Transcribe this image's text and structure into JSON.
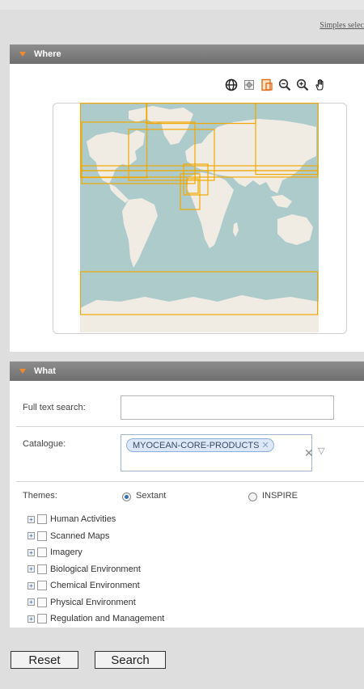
{
  "header": {
    "simple_link": "Simples selec"
  },
  "where": {
    "title": "Where",
    "tools": [
      {
        "icon": "globe-icon"
      },
      {
        "icon": "zoom-extent-icon"
      },
      {
        "icon": "select-box-icon"
      },
      {
        "icon": "zoom-in-icon"
      },
      {
        "icon": "zoom-out-icon"
      },
      {
        "icon": "pan-hand-icon"
      }
    ]
  },
  "what": {
    "title": "What",
    "fulltext": {
      "label": "Full text search:",
      "value": "",
      "placeholder": ""
    },
    "catalogue": {
      "label": "Catalogue:",
      "selected": "MYOCEAN-CORE-PRODUCTS"
    },
    "themes": {
      "label": "Themes:",
      "options": [
        {
          "label": "Sextant",
          "checked": true
        },
        {
          "label": "INSPIRE",
          "checked": false
        }
      ],
      "items": [
        "Human Activities",
        "Scanned Maps",
        "Imagery",
        "Biological Environment",
        "Chemical Environment",
        "Physical Environment",
        "Regulation and Management"
      ]
    }
  },
  "buttons": {
    "reset": "Reset",
    "search": "Search"
  },
  "colors": {
    "header_bg": "#7d7d7d",
    "accent_orange": "#f08a2c",
    "map_water": "#aecbcc",
    "map_land": "#f0ece4",
    "bbox_stroke": "#f0a800"
  }
}
